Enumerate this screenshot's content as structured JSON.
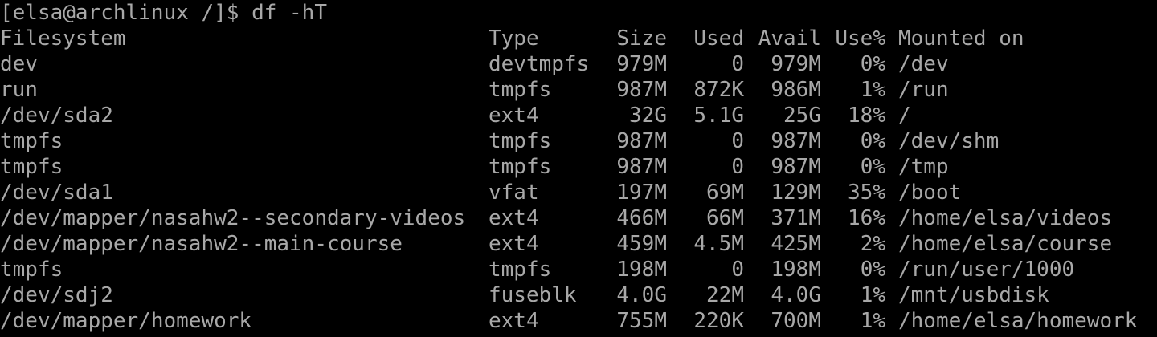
{
  "terminal": {
    "prompt": "[elsa@archlinux /]$ df -hT",
    "header": {
      "filesystem": "Filesystem",
      "type": "Type",
      "size": "Size",
      "used": "Used",
      "avail": "Avail",
      "use_pct": "Use%",
      "mounted_on": "Mounted on"
    },
    "rows": [
      {
        "filesystem": "dev",
        "type": "devtmpfs",
        "size": "979M",
        "used": "0",
        "avail": "979M",
        "use_pct": "0%",
        "mounted_on": "/dev"
      },
      {
        "filesystem": "run",
        "type": "tmpfs",
        "size": "987M",
        "used": "872K",
        "avail": "986M",
        "use_pct": "1%",
        "mounted_on": "/run"
      },
      {
        "filesystem": "/dev/sda2",
        "type": "ext4",
        "size": "32G",
        "used": "5.1G",
        "avail": "25G",
        "use_pct": "18%",
        "mounted_on": "/"
      },
      {
        "filesystem": "tmpfs",
        "type": "tmpfs",
        "size": "987M",
        "used": "0",
        "avail": "987M",
        "use_pct": "0%",
        "mounted_on": "/dev/shm"
      },
      {
        "filesystem": "tmpfs",
        "type": "tmpfs",
        "size": "987M",
        "used": "0",
        "avail": "987M",
        "use_pct": "0%",
        "mounted_on": "/tmp"
      },
      {
        "filesystem": "/dev/sda1",
        "type": "vfat",
        "size": "197M",
        "used": "69M",
        "avail": "129M",
        "use_pct": "35%",
        "mounted_on": "/boot"
      },
      {
        "filesystem": "/dev/mapper/nasahw2--secondary-videos",
        "type": "ext4",
        "size": "466M",
        "used": "66M",
        "avail": "371M",
        "use_pct": "16%",
        "mounted_on": "/home/elsa/videos"
      },
      {
        "filesystem": "/dev/mapper/nasahw2--main-course",
        "type": "ext4",
        "size": "459M",
        "used": "4.5M",
        "avail": "425M",
        "use_pct": "2%",
        "mounted_on": "/home/elsa/course"
      },
      {
        "filesystem": "tmpfs",
        "type": "tmpfs",
        "size": "198M",
        "used": "0",
        "avail": "198M",
        "use_pct": "0%",
        "mounted_on": "/run/user/1000"
      },
      {
        "filesystem": "/dev/sdj2",
        "type": "fuseblk",
        "size": "4.0G",
        "used": "22M",
        "avail": "4.0G",
        "use_pct": "1%",
        "mounted_on": "/mnt/usbdisk"
      },
      {
        "filesystem": "/dev/mapper/homework",
        "type": "ext4",
        "size": "755M",
        "used": "220K",
        "avail": "700M",
        "use_pct": "1%",
        "mounted_on": "/home/elsa/homework"
      }
    ]
  }
}
